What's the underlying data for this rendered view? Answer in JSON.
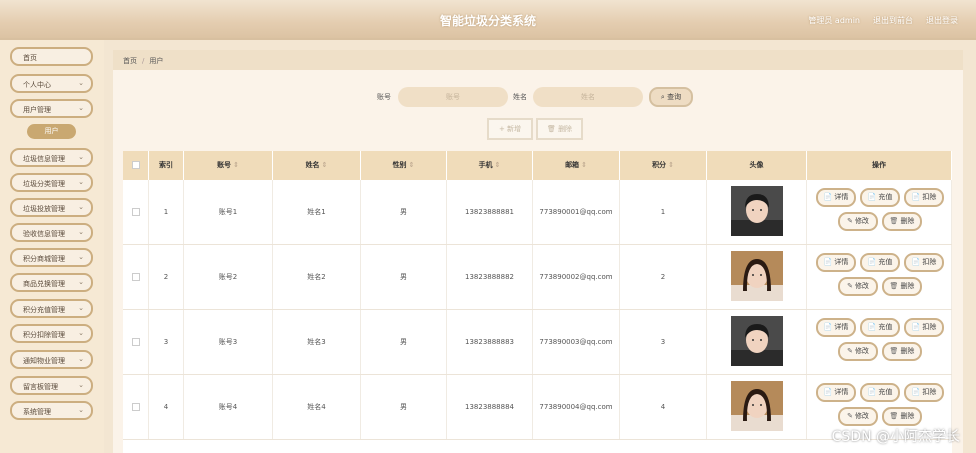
{
  "header": {
    "title": "智能垃圾分类系统",
    "links": [
      "管理员 admin",
      "退出到前台",
      "退出登录"
    ]
  },
  "sidebar": {
    "items": [
      {
        "label": "首页",
        "chevron": false
      },
      {
        "label": "个人中心",
        "chevron": true
      },
      {
        "label": "用户管理",
        "chevron": true
      },
      {
        "label": "垃圾信息管理",
        "chevron": true
      },
      {
        "label": "垃圾分类管理",
        "chevron": true
      },
      {
        "label": "垃圾投放管理",
        "chevron": true
      },
      {
        "label": "验收信息管理",
        "chevron": true
      },
      {
        "label": "积分商城管理",
        "chevron": true
      },
      {
        "label": "商品兑换管理",
        "chevron": true
      },
      {
        "label": "积分充值管理",
        "chevron": true
      },
      {
        "label": "积分扣除管理",
        "chevron": true
      },
      {
        "label": "通知物业管理",
        "chevron": true
      },
      {
        "label": "留言板管理",
        "chevron": true
      },
      {
        "label": "系统管理",
        "chevron": true
      }
    ],
    "active_sub": "用户"
  },
  "breadcrumb": {
    "home": "首页",
    "sep": "/",
    "current": "用户"
  },
  "search": {
    "account_label": "账号",
    "account_placeholder": "账号",
    "name_label": "姓名",
    "name_placeholder": "姓名",
    "query_button": "查询"
  },
  "actions": {
    "add": "新增",
    "delete": "删除"
  },
  "table": {
    "columns": [
      "索引",
      "账号",
      "姓名",
      "性别",
      "手机",
      "邮箱",
      "积分",
      "头像",
      "操作"
    ],
    "ops": [
      "详情",
      "充值",
      "扣除",
      "修改",
      "删除"
    ],
    "rows": [
      {
        "index": "1",
        "account": "账号1",
        "name": "姓名1",
        "gender": "男",
        "phone": "13823888881",
        "email": "773890001@qq.com",
        "points": "1",
        "avatar": "male-portrait"
      },
      {
        "index": "2",
        "account": "账号2",
        "name": "姓名2",
        "gender": "男",
        "phone": "13823888882",
        "email": "773890002@qq.com",
        "points": "2",
        "avatar": "female-portrait"
      },
      {
        "index": "3",
        "account": "账号3",
        "name": "姓名3",
        "gender": "男",
        "phone": "13823888883",
        "email": "773890003@qq.com",
        "points": "3",
        "avatar": "male-portrait"
      },
      {
        "index": "4",
        "account": "账号4",
        "name": "姓名4",
        "gender": "男",
        "phone": "13823888884",
        "email": "773890004@qq.com",
        "points": "4",
        "avatar": "female-portrait"
      }
    ]
  },
  "watermark": "CSDN @小阿杰学长",
  "colors": {
    "accent": "#c9a871",
    "header_bg": "#f0dcba",
    "border": "#cdb28a"
  }
}
